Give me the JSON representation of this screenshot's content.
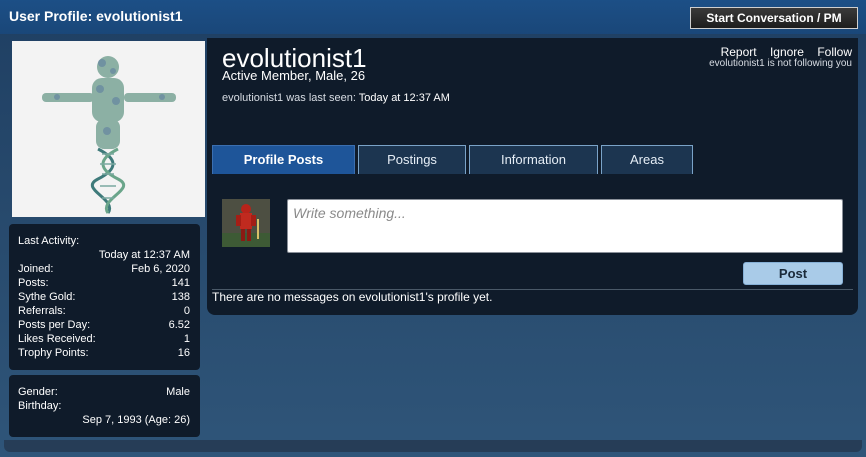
{
  "header": {
    "title": "User Profile: evolutionist1",
    "start_conversation_label": "Start Conversation / PM"
  },
  "profile": {
    "username": "evolutionist1",
    "user_title": "Active Member, Male, 26",
    "last_seen_prefix": "evolutionist1 was last seen:",
    "last_seen_value": "Today at 12:37 AM",
    "actions": [
      "Report",
      "Ignore",
      "Follow"
    ],
    "follow_note": "evolutionist1 is not following you"
  },
  "tabs": [
    {
      "label": "Profile Posts",
      "active": true
    },
    {
      "label": "Postings",
      "active": false
    },
    {
      "label": "Information",
      "active": false
    },
    {
      "label": "Areas",
      "active": false
    }
  ],
  "stats": {
    "last_activity_label": "Last Activity:",
    "last_activity_value": "Today at 12:37 AM",
    "items": [
      {
        "label": "Joined:",
        "value": "Feb 6, 2020"
      },
      {
        "label": "Posts:",
        "value": "141"
      },
      {
        "label": "Sythe Gold:",
        "value": "138"
      },
      {
        "label": "Referrals:",
        "value": "0"
      },
      {
        "label": "Posts per Day:",
        "value": "6.52"
      },
      {
        "label": "Likes Received:",
        "value": "1"
      },
      {
        "label": "Trophy Points:",
        "value": "16"
      }
    ]
  },
  "personal": {
    "gender_label": "Gender:",
    "gender_value": "Male",
    "birthday_label": "Birthday:",
    "birthday_value": "Sep 7, 1993 (Age: 26)"
  },
  "profile_posts": {
    "placeholder": "Write something...",
    "post_button_label": "Post",
    "empty_message": "There are no messages on evolutionist1's profile yet."
  },
  "colors": {
    "accent": "#1e5599",
    "panel": "#0f1b2a",
    "post_button": "#a9cbe8"
  }
}
